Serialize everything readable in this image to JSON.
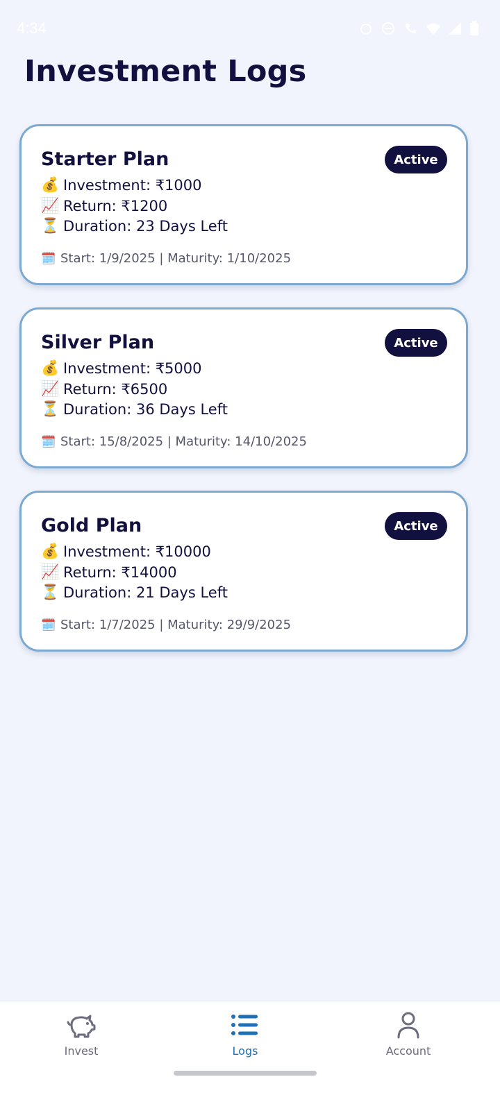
{
  "status_bar": {
    "time": "4:34"
  },
  "page": {
    "title": "Investment Logs"
  },
  "plans": [
    {
      "name": "Starter Plan",
      "status": "Active",
      "investment": "Investment: ₹1000",
      "return": "Return: ₹1200",
      "duration": "Duration: 23 Days Left",
      "dates": "Start: 1/9/2025 | Maturity: 1/10/2025"
    },
    {
      "name": "Silver Plan",
      "status": "Active",
      "investment": "Investment: ₹5000",
      "return": "Return: ₹6500",
      "duration": "Duration: 36 Days Left",
      "dates": "Start: 15/8/2025 | Maturity: 14/10/2025"
    },
    {
      "name": "Gold Plan",
      "status": "Active",
      "investment": "Investment: ₹10000",
      "return": "Return: ₹14000",
      "duration": "Duration: 21 Days Left",
      "dates": "Start: 1/7/2025 | Maturity: 29/9/2025"
    }
  ],
  "icons": {
    "investment": "💰",
    "return": "📈",
    "duration": "⏳",
    "calendar": "🗓️"
  },
  "nav": {
    "items": [
      {
        "label": "Invest",
        "icon": "piggy-bank-icon"
      },
      {
        "label": "Logs",
        "icon": "list-icon",
        "active": true
      },
      {
        "label": "Account",
        "icon": "user-icon"
      }
    ]
  },
  "colors": {
    "background": "#f1f4fc",
    "primary_text": "#12103f",
    "card_border": "#7ba9d2",
    "badge_bg": "#12103f",
    "nav_active": "#1e6fb5",
    "nav_inactive": "#6b6c7e"
  }
}
